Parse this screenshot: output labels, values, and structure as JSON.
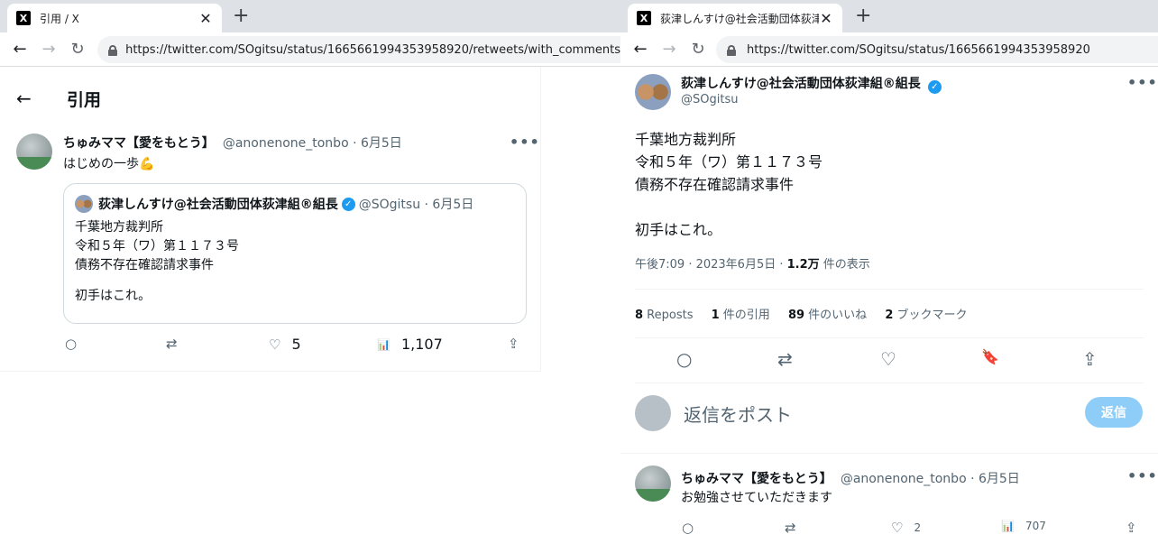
{
  "left": {
    "tab": {
      "favicon": "X",
      "title": "引用 / X",
      "close": "✕"
    },
    "newtab": "+",
    "url": "https://twitter.com/SOgitsu/status/1665661994353958920/retweets/with_comments",
    "header": {
      "back": "←",
      "title": "引用"
    },
    "tweet": {
      "name": "ちゅみママ【愛をもとう】",
      "handle_date": "@anonenone_tonbo · 6月5日",
      "text": "はじめの一歩💪",
      "more": "•••",
      "quote": {
        "name": "荻津しんすけ@社会活動団体荻津組®組長",
        "verified": "✓",
        "handle_date": "@SOgitsu · 6月5日",
        "lines": [
          "千葉地方裁判所",
          "令和５年（ワ）第１１７３号",
          "債務不存在確認請求事件",
          "初手はこれ。"
        ]
      },
      "likes": "5",
      "views": "1,107"
    }
  },
  "right": {
    "tab": {
      "favicon": "X",
      "title": "荻津しんすけ@社会活動団体荻津組",
      "close": "✕"
    },
    "newtab": "+",
    "url": "https://twitter.com/SOgitsu/status/1665661994353958920",
    "author": {
      "name": "荻津しんすけ@社会活動団体荻津組®組長",
      "verified": "✓",
      "handle": "@SOgitsu",
      "more": "•••"
    },
    "lines": [
      "千葉地方裁判所",
      "令和５年（ワ）第１１７３号",
      "債務不存在確認請求事件",
      "初手はこれ。"
    ],
    "timestamp": "午後7:09 · 2023年6月5日 · ",
    "views_count": "1.2万",
    "views_label": " 件の表示",
    "stats": [
      {
        "num": "8",
        "label": " Reposts"
      },
      {
        "num": "1",
        "label": " 件の引用"
      },
      {
        "num": "89",
        "label": " 件のいいね"
      },
      {
        "num": "2",
        "label": " ブックマーク"
      }
    ],
    "reply_placeholder": "返信をポスト",
    "reply_button": "返信",
    "reply": {
      "name": "ちゅみママ【愛をもとう】",
      "handle_date": "@anonenone_tonbo · 6月5日",
      "text": "お勉強させていただきます",
      "more": "•••",
      "likes": "2",
      "views": "707"
    }
  },
  "icons": {
    "back": "←",
    "forward": "→",
    "reload": "↻",
    "reply": "○",
    "retweet": "⇄",
    "like": "♡",
    "views": "📊",
    "share": "⇪",
    "bookmark": "🔖"
  }
}
